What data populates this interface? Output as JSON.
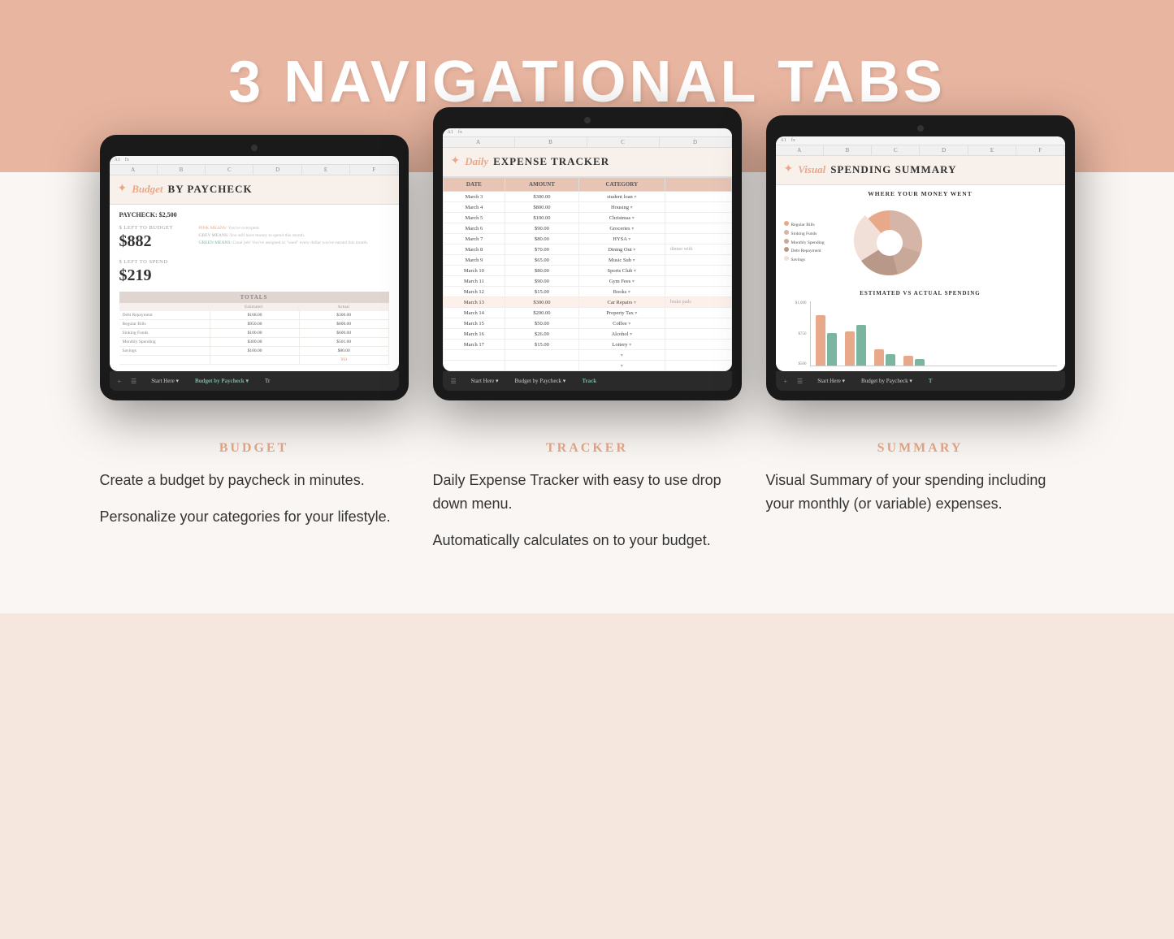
{
  "page": {
    "title": "3 NAVIGATIONAL TABS",
    "background_top": "#e8b5a0",
    "background_bottom": "#faf6f3"
  },
  "tablets": [
    {
      "id": "budget",
      "type": "Budget by Paycheck",
      "sheet_title_italic": "Budget",
      "sheet_title_bold": "BY PAYCHECK",
      "paycheck_label": "PAYCHECK:",
      "paycheck_amount": "$2,500",
      "left_to_budget_label": "$ LEFT TO BUDGET",
      "left_to_budget_amount": "$882",
      "left_to_spend_label": "$ LEFT TO SPEND",
      "left_to_spend_amount": "$219",
      "hints": {
        "pink": "PINK MEANS: You've overspent.",
        "grey": "GREY MEANS: You still have money to spend this month.",
        "green": "GREEN MEANS: Great job! You've assigned or \"used\" every dollar you've earned this month."
      },
      "totals": {
        "header": "TOTALS",
        "columns": [
          "",
          "Estimated",
          "Actual"
        ],
        "rows": [
          [
            "Debt Repayment",
            "$168.00",
            "$300.00"
          ],
          [
            "Regular Bills",
            "$950.00",
            "$800.00"
          ],
          [
            "Sinking Funds",
            "$100.00",
            "$600.00"
          ],
          [
            "Monthly Spending",
            "$300.00",
            "$501.00"
          ],
          [
            "Savings",
            "$100.00",
            "$80.00"
          ]
        ]
      },
      "tabs": [
        "Start Here",
        "Budget by Paycheck",
        "Tr"
      ]
    },
    {
      "id": "tracker",
      "type": "Daily Expense Tracker",
      "sheet_title_italic": "Daily",
      "sheet_title_bold": "EXPENSE TRACKER",
      "columns": [
        "DATE",
        "AMOUNT",
        "CATEGORY"
      ],
      "rows": [
        [
          "March 3",
          "$300.00",
          "student loan",
          ""
        ],
        [
          "March 4",
          "$800.00",
          "Housing",
          ""
        ],
        [
          "March 5",
          "$100.00",
          "Christmas",
          ""
        ],
        [
          "March 6",
          "$90.00",
          "Groceries",
          ""
        ],
        [
          "March 7",
          "$80.00",
          "HYSA",
          ""
        ],
        [
          "March 8",
          "$70.00",
          "Dining Out",
          "dinner with"
        ],
        [
          "March 9",
          "$65.00",
          "Music Sub",
          ""
        ],
        [
          "March 10",
          "$80.00",
          "Sports Club",
          ""
        ],
        [
          "March 11",
          "$90.00",
          "Gym Fees",
          ""
        ],
        [
          "March 12",
          "$15.00",
          "Books",
          ""
        ],
        [
          "March 13",
          "$300.00",
          "Car Repairs",
          "brake pads"
        ],
        [
          "March 14",
          "$200.00",
          "Property Tax",
          ""
        ],
        [
          "March 15",
          "$50.00",
          "Coffee",
          ""
        ],
        [
          "March 16",
          "$26.00",
          "Alcohol",
          ""
        ],
        [
          "March 17",
          "$15.00",
          "Lottery",
          ""
        ]
      ],
      "tabs": [
        "Start Here",
        "Budget by Paycheck",
        "Track"
      ]
    },
    {
      "id": "summary",
      "type": "Visual Spending Summary",
      "sheet_title_italic": "Visual",
      "sheet_title_bold": "SPENDING SUMMARY",
      "pie_title": "WHERE YOUR MONEY WENT",
      "legend": [
        {
          "label": "Regular Bills",
          "color": "#e8a88a"
        },
        {
          "label": "Sinking Funds",
          "color": "#d4b5a8"
        },
        {
          "label": "Monthly Spending",
          "color": "#c8a898"
        },
        {
          "label": "Debt Repayment",
          "color": "#b89888"
        },
        {
          "label": "Savings",
          "color": "#f0e0d8"
        }
      ],
      "bar_title": "ESTIMATED VS ACTUAL SPENDING",
      "bar_y_labels": [
        "$1,000",
        "$750",
        "$500"
      ],
      "bar_groups": [
        {
          "estimated": 90,
          "actual": 58
        },
        {
          "estimated": 52,
          "actual": 60
        },
        {
          "estimated": 25,
          "actual": 18
        },
        {
          "estimated": 15,
          "actual": 10
        }
      ],
      "tabs": [
        "Start Here",
        "Budget by Paycheck",
        "T"
      ]
    }
  ],
  "info_sections": [
    {
      "category": "BUDGET",
      "paragraphs": [
        "Create a budget by paycheck in minutes.",
        "Personalize your categories for your lifestyle."
      ]
    },
    {
      "category": "TRACKER",
      "paragraphs": [
        "Daily Expense Tracker with easy to use drop down menu.",
        "Automatically calculates on to your budget."
      ]
    },
    {
      "category": "SUMMARY",
      "paragraphs": [
        "Visual Summary of your spending including your monthly (or variable) expenses."
      ]
    }
  ]
}
